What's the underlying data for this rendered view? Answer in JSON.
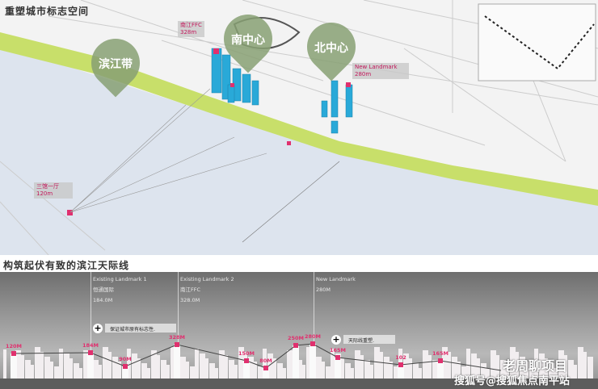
{
  "map": {
    "title": "重塑城市标志空间",
    "bubbles": [
      "滨江带",
      "南中心",
      "北中心"
    ],
    "tags": [
      {
        "name": "南江FFC",
        "height": "328m"
      },
      {
        "name": "New Landmark",
        "height": "280m"
      },
      {
        "name": "三馆一厅",
        "height": "120m"
      }
    ]
  },
  "skyline": {
    "title": "构筑起伏有致的滨江天际线",
    "landmarks": [
      {
        "label": "Existing Landmark  1",
        "name": "恒通国际",
        "height": "184.0M"
      },
      {
        "label": "Existing Landmark  2",
        "name": "南江FFC",
        "height": "328.0M"
      },
      {
        "label": "New Landmark",
        "height": "280M"
      }
    ],
    "notes": [
      "保证城市原有标志性.",
      "天际线重塑."
    ],
    "heights": [
      "120M",
      "184M",
      "90M",
      "328M",
      "150M",
      "80M",
      "250M",
      "280M",
      "165M",
      "102",
      "165M"
    ]
  },
  "watermark": {
    "account": "老周聊项目",
    "source": "搜狐号@搜狐焦点南平站"
  },
  "colors": {
    "accent": "#e0306e",
    "tower": "#29a9d8",
    "green": "#c8df6a",
    "river": "#dde4ee"
  }
}
